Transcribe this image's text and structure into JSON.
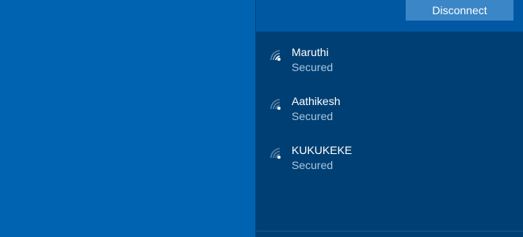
{
  "connected": {
    "disconnect_label": "Disconnect"
  },
  "networks": [
    {
      "name": "Maruthi",
      "status": "Secured",
      "icon": "wifi-icon"
    },
    {
      "name": "Aathikesh",
      "status": "Secured",
      "icon": "wifi-icon"
    },
    {
      "name": "KUKUKEKE",
      "status": "Secured",
      "icon": "wifi-icon"
    }
  ],
  "colors": {
    "desktop": "#0063b1",
    "flyout": "#003f73",
    "button": "#3a86c6",
    "status_text": "#a8c6e0"
  }
}
